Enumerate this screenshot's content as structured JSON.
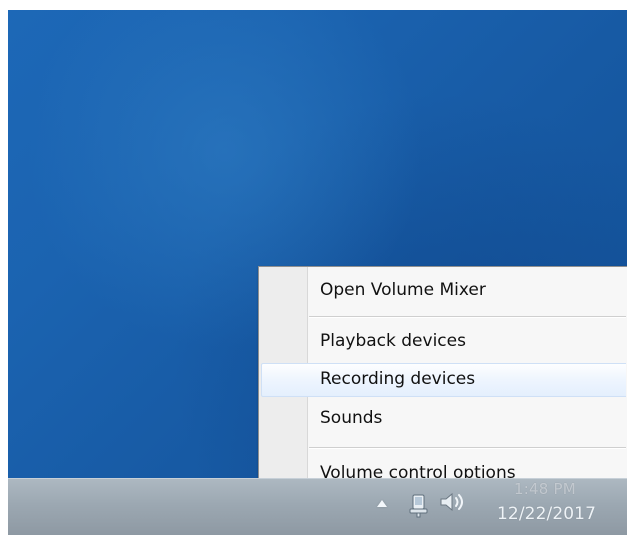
{
  "context_menu": {
    "items": [
      {
        "label": "Open Volume Mixer"
      },
      {
        "label": "Playback devices"
      },
      {
        "label": "Recording devices",
        "state": "hovered"
      },
      {
        "label": "Sounds"
      },
      {
        "label": "Volume control options"
      }
    ]
  },
  "taskbar": {
    "clock": {
      "time": "1:48 PM",
      "date": "12/22/2017"
    },
    "tray_icons": [
      {
        "name": "show-hidden-icons-arrow"
      },
      {
        "name": "network-icon"
      },
      {
        "name": "speaker-icon"
      }
    ]
  },
  "colors": {
    "desktop_blue": "#1b63b0",
    "taskbar_gray": "#9ca8b2",
    "menu_background": "#f7f7f7",
    "menu_highlight": "#eef5fe"
  }
}
